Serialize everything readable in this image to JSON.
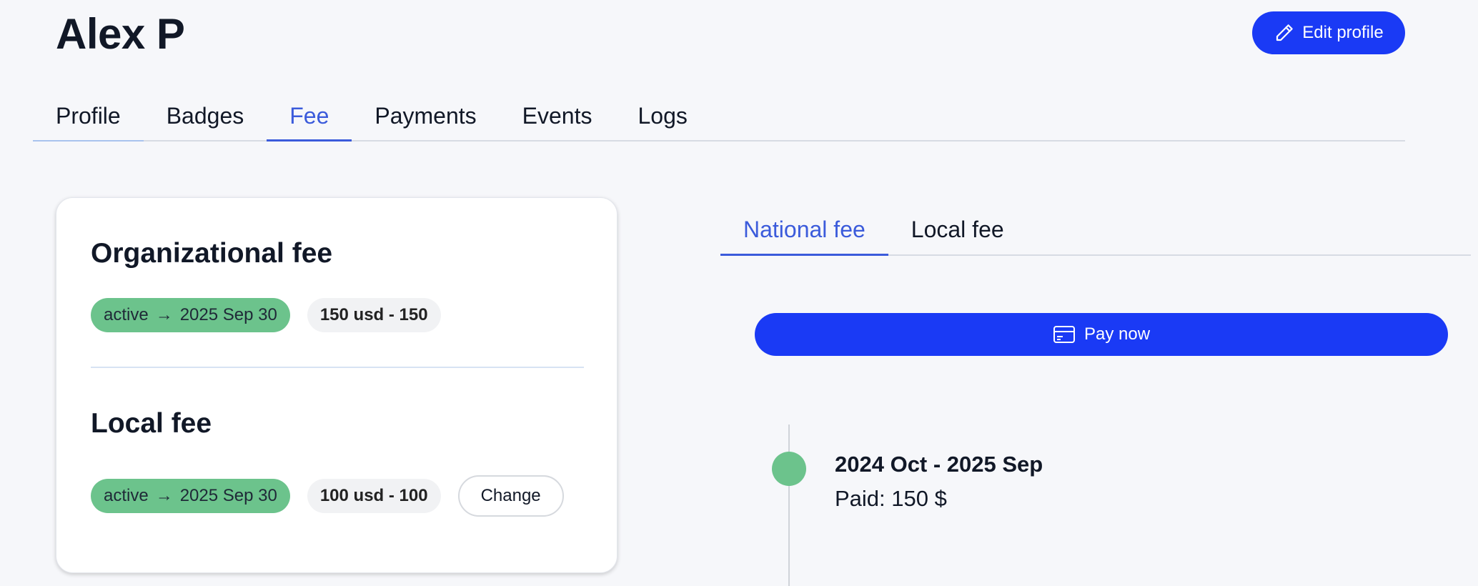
{
  "header": {
    "user_name": "Alex P",
    "edit_profile_label": "Edit profile"
  },
  "main_tabs": [
    {
      "label": "Profile"
    },
    {
      "label": "Badges"
    },
    {
      "label": "Fee",
      "active": true
    },
    {
      "label": "Payments"
    },
    {
      "label": "Events"
    },
    {
      "label": "Logs"
    }
  ],
  "fee_card": {
    "organizational": {
      "title": "Organizational fee",
      "status": "active",
      "arrow": "→",
      "valid_until": "2025 Sep 30",
      "amount": "150 usd - 150"
    },
    "local": {
      "title": "Local fee",
      "status": "active",
      "arrow": "→",
      "valid_until": "2025 Sep 30",
      "amount": "100 usd - 100",
      "change_label": "Change"
    }
  },
  "fee_tabs": [
    {
      "label": "National fee",
      "active": true
    },
    {
      "label": "Local fee"
    }
  ],
  "pay_now_label": "Pay now",
  "timeline": [
    {
      "period": "2024 Oct - 2025 Sep",
      "paid": "Paid: 150 $"
    }
  ],
  "colors": {
    "primary": "#1a3af5",
    "active_tab": "#3b5bdb",
    "status_green": "#6cc38c",
    "background": "#f6f7fa"
  },
  "icons": {
    "edit": "pencil-icon",
    "pay": "credit-card-icon",
    "valid_until": "arrow-right-icon"
  }
}
